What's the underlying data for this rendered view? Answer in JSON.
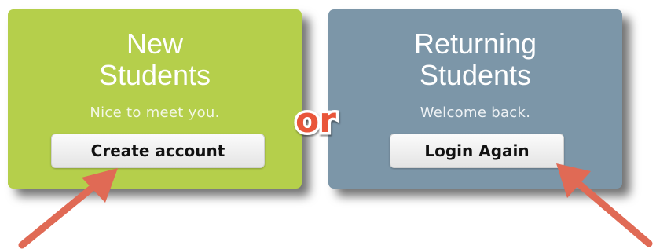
{
  "new_students": {
    "title_line1": "New",
    "title_line2": "Students",
    "subtitle": "Nice to meet you.",
    "button_label": "Create account"
  },
  "separator": {
    "label": "or"
  },
  "returning_students": {
    "title_line1": "Returning",
    "title_line2": "Students",
    "subtitle": "Welcome back.",
    "button_label": "Login Again"
  },
  "colors": {
    "new_card": "#b5cf4b",
    "returning_card": "#7c96a8",
    "or_fill": "#e9563a",
    "arrow": "#e06a55"
  },
  "icons": {
    "left_arrow": "arrow-up-right-icon",
    "right_arrow": "arrow-up-left-icon"
  }
}
